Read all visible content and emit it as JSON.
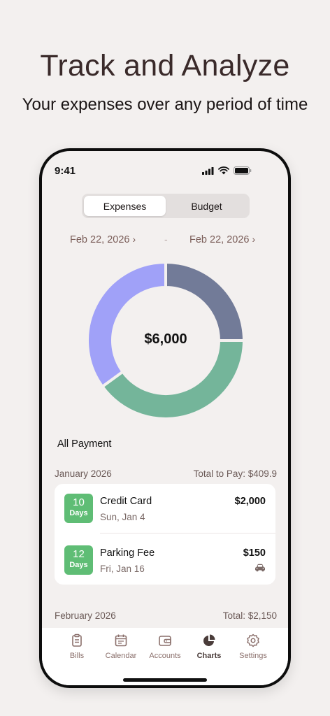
{
  "promo": {
    "headline": "Track and Analyze",
    "subline": "Your expenses over any period of time"
  },
  "status_bar": {
    "time": "9:41"
  },
  "segmented": {
    "options": [
      "Expenses",
      "Budget"
    ],
    "selected": "Expenses"
  },
  "date_range": {
    "start": "Feb 22, 2026",
    "separator": "-",
    "end": "Feb 22, 2026"
  },
  "chart_data": {
    "type": "pie",
    "donut": true,
    "center_label": "$6,000",
    "slices": [
      {
        "value": 25,
        "color": "#727b98"
      },
      {
        "value": 40,
        "color": "#74b59a"
      },
      {
        "value": 35,
        "color": "#a0a1f8"
      }
    ]
  },
  "section_title": "All Payment",
  "groups": [
    {
      "month": "January 2026",
      "total": "Total to Pay: $409.9",
      "items": [
        {
          "days": "10",
          "days_unit": "Days",
          "title": "Credit Card",
          "date": "Sun, Jan 4",
          "amount": "$2,000",
          "icon": "none"
        },
        {
          "days": "12",
          "days_unit": "Days",
          "title": "Parking Fee",
          "date": "Fri, Jan 16",
          "amount": "$150",
          "icon": "car-icon"
        }
      ]
    },
    {
      "month": "February 2026",
      "total": "Total: $2,150",
      "items": []
    }
  ],
  "tabbar": {
    "items": [
      {
        "label": "Bills",
        "icon": "bills-icon"
      },
      {
        "label": "Calendar",
        "icon": "calendar-icon"
      },
      {
        "label": "Accounts",
        "icon": "wallet-icon"
      },
      {
        "label": "Charts",
        "icon": "pie-chart-icon"
      },
      {
        "label": "Settings",
        "icon": "gear-icon"
      }
    ],
    "active": "Charts"
  },
  "colors": {
    "accent_green": "#5fbd75",
    "text_brown": "#7a5d58",
    "background": "#f3f0ef"
  }
}
